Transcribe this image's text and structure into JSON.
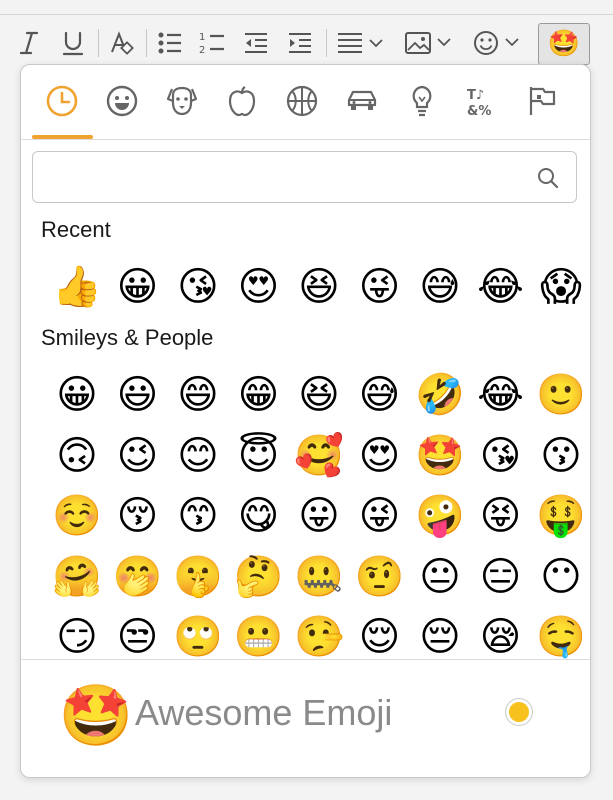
{
  "toolbar": {
    "buttons": [
      "italic-icon",
      "underline-icon",
      "clear-format-icon",
      "bulleted-list-icon",
      "numbered-list-icon",
      "decrease-indent-icon",
      "increase-indent-icon",
      "align-icon",
      "image-icon",
      "emoji-icon",
      "awesome-emoji-icon"
    ],
    "active_emoji": "🤩"
  },
  "categories": [
    {
      "name": "recent",
      "icon": "clock-icon",
      "active": true
    },
    {
      "name": "smileys",
      "icon": "smiley-icon"
    },
    {
      "name": "animals",
      "icon": "dog-icon"
    },
    {
      "name": "food",
      "icon": "apple-icon"
    },
    {
      "name": "activities",
      "icon": "basketball-icon"
    },
    {
      "name": "travel",
      "icon": "car-icon"
    },
    {
      "name": "objects",
      "icon": "lightbulb-icon"
    },
    {
      "name": "symbols",
      "icon": "symbols-icon"
    },
    {
      "name": "flags",
      "icon": "flags-icon"
    }
  ],
  "accent_color": "#f0a331",
  "search": {
    "placeholder": "",
    "value": ""
  },
  "sections": {
    "recent_title": "Recent",
    "smileys_title": "Smileys & People"
  },
  "recent": [
    "👍",
    "😀",
    "😘",
    "😍",
    "😆",
    "😜",
    "😅",
    "😂",
    "😱"
  ],
  "smileys": [
    [
      "😀",
      "😃",
      "😄",
      "😁",
      "😆",
      "😅",
      "🤣",
      "😂",
      "🙂"
    ],
    [
      "🙃",
      "😉",
      "😊",
      "😇",
      "🥰",
      "😍",
      "🤩",
      "😘",
      "😗"
    ],
    [
      "☺️",
      "😚",
      "😙",
      "😋",
      "😛",
      "😜",
      "🤪",
      "😝",
      "🤑"
    ],
    [
      "🤗",
      "🤭",
      "🤫",
      "🤔",
      "🤐",
      "🤨",
      "😐",
      "😑",
      "😶"
    ],
    [
      "😏",
      "😒",
      "🙄",
      "😬",
      "🤥",
      "😌",
      "😔",
      "😪",
      "🤤"
    ]
  ],
  "footer": {
    "emoji": "🤩",
    "name": "Awesome Emoji",
    "skin_tone_color": "#f7c21d"
  }
}
